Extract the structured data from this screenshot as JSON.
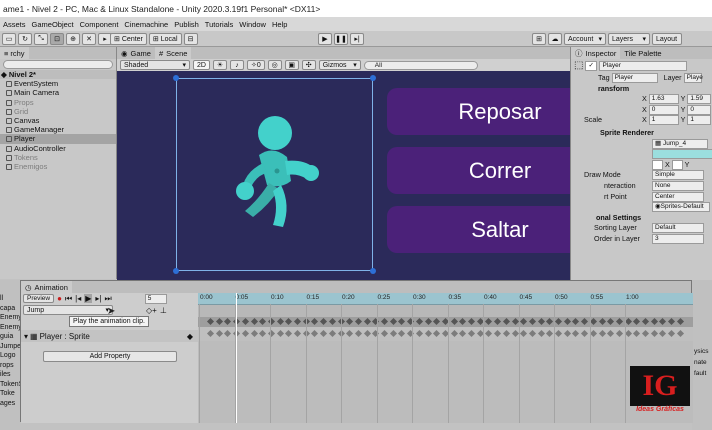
{
  "titlebar": {
    "text": "ame1 - Nivel 2 - PC, Mac & Linux Standalone - Unity 2020.3.19f1 Personal* <DX11>"
  },
  "menubar": {
    "items": [
      "Assets",
      "GameObject",
      "Component",
      "Cinemachine",
      "Publish",
      "Tutorials",
      "Window",
      "Help"
    ]
  },
  "toolbar": {
    "center_label": "Center",
    "local_label": "Local",
    "account_label": "Account",
    "layers_label": "Layers",
    "layout_label": "Layout"
  },
  "scene_tabs": {
    "game": "Game",
    "scene": "Scene"
  },
  "scene_toolbar": {
    "shading": "Shaded",
    "mode_2d": "2D",
    "fx_count": "0",
    "gizmos": "Gizmos",
    "search_placeholder": "All"
  },
  "hierarchy": {
    "tab": "rchy",
    "search_placeholder": "",
    "scene_name": "Nivel 2*",
    "items": [
      {
        "label": "EventSystem",
        "dim": false
      },
      {
        "label": "Main Camera",
        "dim": false
      },
      {
        "label": "Props",
        "dim": true
      },
      {
        "label": "Grid",
        "dim": true
      },
      {
        "label": "Canvas",
        "dim": false
      },
      {
        "label": "GameManager",
        "dim": false
      },
      {
        "label": "Player",
        "dim": false
      },
      {
        "label": "AudioController",
        "dim": false
      },
      {
        "label": "Tokens",
        "dim": true
      },
      {
        "label": "Enemigos",
        "dim": true
      }
    ]
  },
  "scene_buttons": {
    "b1": "Reposar",
    "b2": "Correr",
    "b3": "Saltar"
  },
  "inspector": {
    "tab1": "Inspector",
    "tab2": "Tile Palette",
    "object_name": "Player",
    "tag_label": "Tag",
    "tag_value": "Player",
    "layer_label": "Layer",
    "layer_value": "Playe",
    "transform_header": "ransform",
    "pos": {
      "x": "1.63",
      "y": "1.59"
    },
    "rot": {
      "x": "0",
      "y": "0"
    },
    "scale_label": "Scale",
    "scale": {
      "x": "1",
      "y": "1"
    },
    "sprite_renderer": "Sprite Renderer",
    "sprite_value": "Jump_4",
    "flip_x": "X",
    "flip_y": "Y",
    "draw_mode_label": "Draw Mode",
    "draw_mode_value": "Simple",
    "mask_label": "nteraction",
    "mask_value": "None",
    "pivot_label": "rt Point",
    "pivot_value": "Center",
    "material_value": "Sprites-Default",
    "additional_header": "onal Settings",
    "sorting_layer_label": "Sorting Layer",
    "sorting_layer_value": "Default",
    "order_label": "Order in Layer",
    "order_value": "3"
  },
  "animation": {
    "tab": "Animation",
    "preview": "Preview",
    "frame": "5",
    "clip": "Jump",
    "tooltip": "Play the animation clip.",
    "property": "Player : Sprite",
    "add_property": "Add Property",
    "ticks": [
      "0:00",
      "0:05",
      "0:10",
      "0:15",
      "0:20",
      "0:25",
      "0:30",
      "0:35",
      "0:40",
      "0:45",
      "0:50",
      "0:55",
      "1:00"
    ]
  },
  "left_strip": {
    "items": [
      "ll",
      "capa",
      "Enemy",
      "Enemy",
      "guia",
      "Jumper",
      "Logo",
      "rops",
      "iles",
      "TokenS",
      "Toke",
      "ages"
    ]
  },
  "right_strip": {
    "items": [
      "ysics",
      "nate",
      "fault"
    ]
  },
  "logo": {
    "text": "IG",
    "subtext": "Ideas Gráficas"
  },
  "colors": {
    "scene_bg": "#2b2a5a",
    "button_purple": "#4b2179",
    "character": "#43d1cb",
    "timeline_blue": "#9bc4cf",
    "logo_red": "#d81e1e"
  }
}
